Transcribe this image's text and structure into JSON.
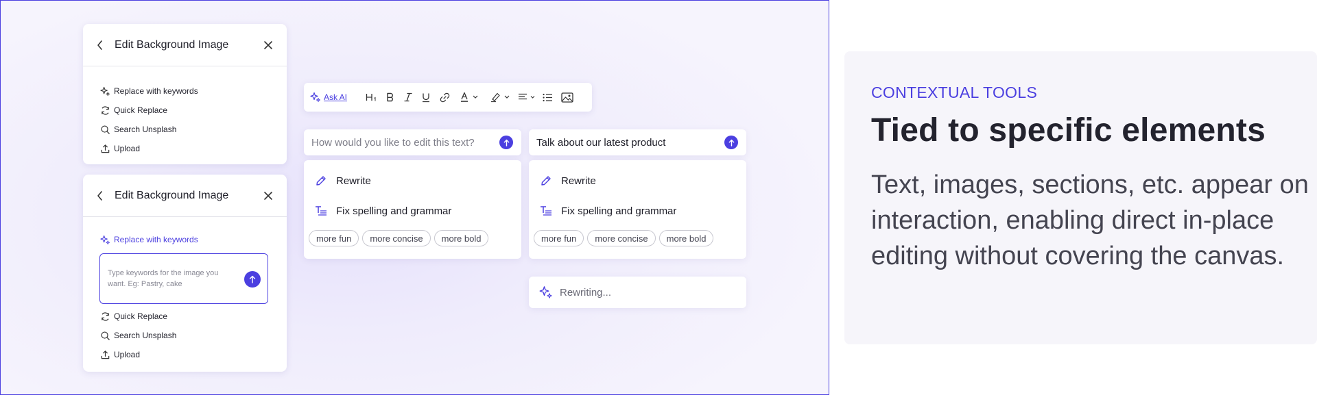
{
  "panel_top": {
    "title": "Edit Background Image",
    "options": [
      "Replace with keywords",
      "Quick Replace",
      "Search Unsplash",
      "Upload"
    ]
  },
  "panel_bottom": {
    "title": "Edit Background Image",
    "active_option": "Replace with keywords",
    "keyword_placeholder": "Type keywords for the image you want. Eg: Pastry, cake",
    "options": [
      "Quick Replace",
      "Search Unsplash",
      "Upload"
    ]
  },
  "toolbar": {
    "ask_ai_label": "Ask AI",
    "icons": [
      "sparkle-icon",
      "heading-icon",
      "bold-icon",
      "italic-icon",
      "underline-icon",
      "link-icon",
      "text-color-icon",
      "highlighter-icon",
      "align-icon",
      "list-icon",
      "image-icon"
    ]
  },
  "prompt_left": {
    "placeholder": "How would you like to edit this text?",
    "value": ""
  },
  "prompt_right": {
    "placeholder": "",
    "value": "Talk about our latest product"
  },
  "menu": {
    "items": [
      "Rewrite",
      "Fix spelling and grammar"
    ],
    "chips": [
      "more fun",
      "more concise",
      "more bold"
    ]
  },
  "status": {
    "rewriting_label": "Rewriting..."
  },
  "info": {
    "eyebrow": "CONTEXTUAL TOOLS",
    "heading": "Tied to specific elements",
    "body": "Text, images, sections, etc. appear on interaction, enabling direct in-place editing without covering the canvas."
  },
  "colors": {
    "accent": "#4b3fe0",
    "canvas_border": "#4b3fe0",
    "info_bg": "#f6f5fa"
  }
}
